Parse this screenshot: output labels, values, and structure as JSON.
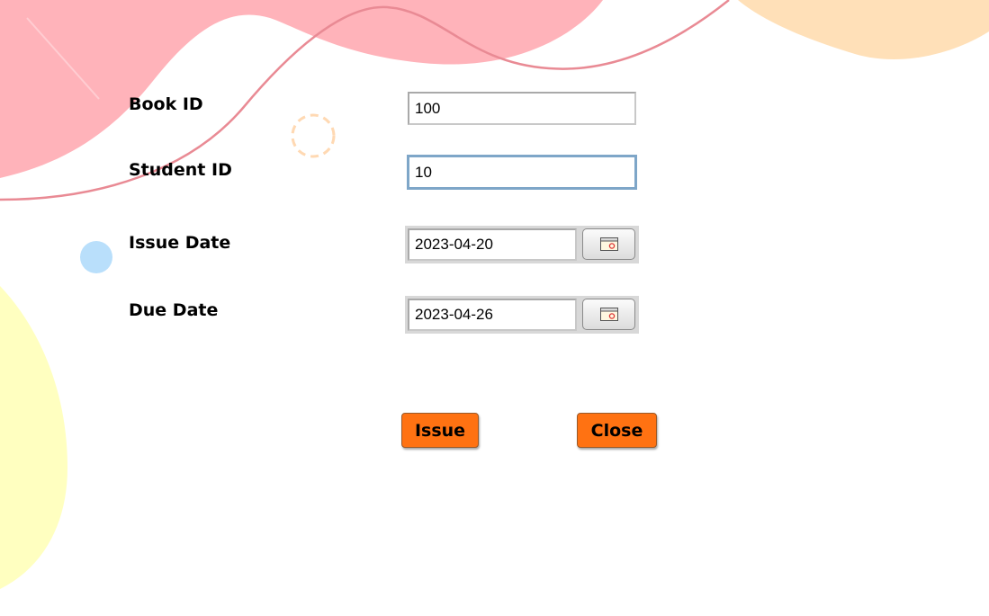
{
  "form": {
    "book_id": {
      "label": "Book ID",
      "value": "100"
    },
    "student_id": {
      "label": "Student ID",
      "value": "10"
    },
    "issue_date": {
      "label": "Issue Date",
      "value": "2023-04-20",
      "picker_icon": "calendar-icon"
    },
    "due_date": {
      "label": "Due Date",
      "value": "2023-04-26",
      "picker_icon": "calendar-icon"
    }
  },
  "buttons": {
    "issue": "Issue",
    "close": "Close"
  },
  "colors": {
    "button": "#ff7212",
    "focus_border": "#7ea6c8",
    "blob_pink": "#ffb3ba",
    "blob_peach": "#ffe0b8",
    "blob_yellow": "#ffffc0",
    "blob_blue": "#b9dffb",
    "wave_line": "#e98a94"
  }
}
